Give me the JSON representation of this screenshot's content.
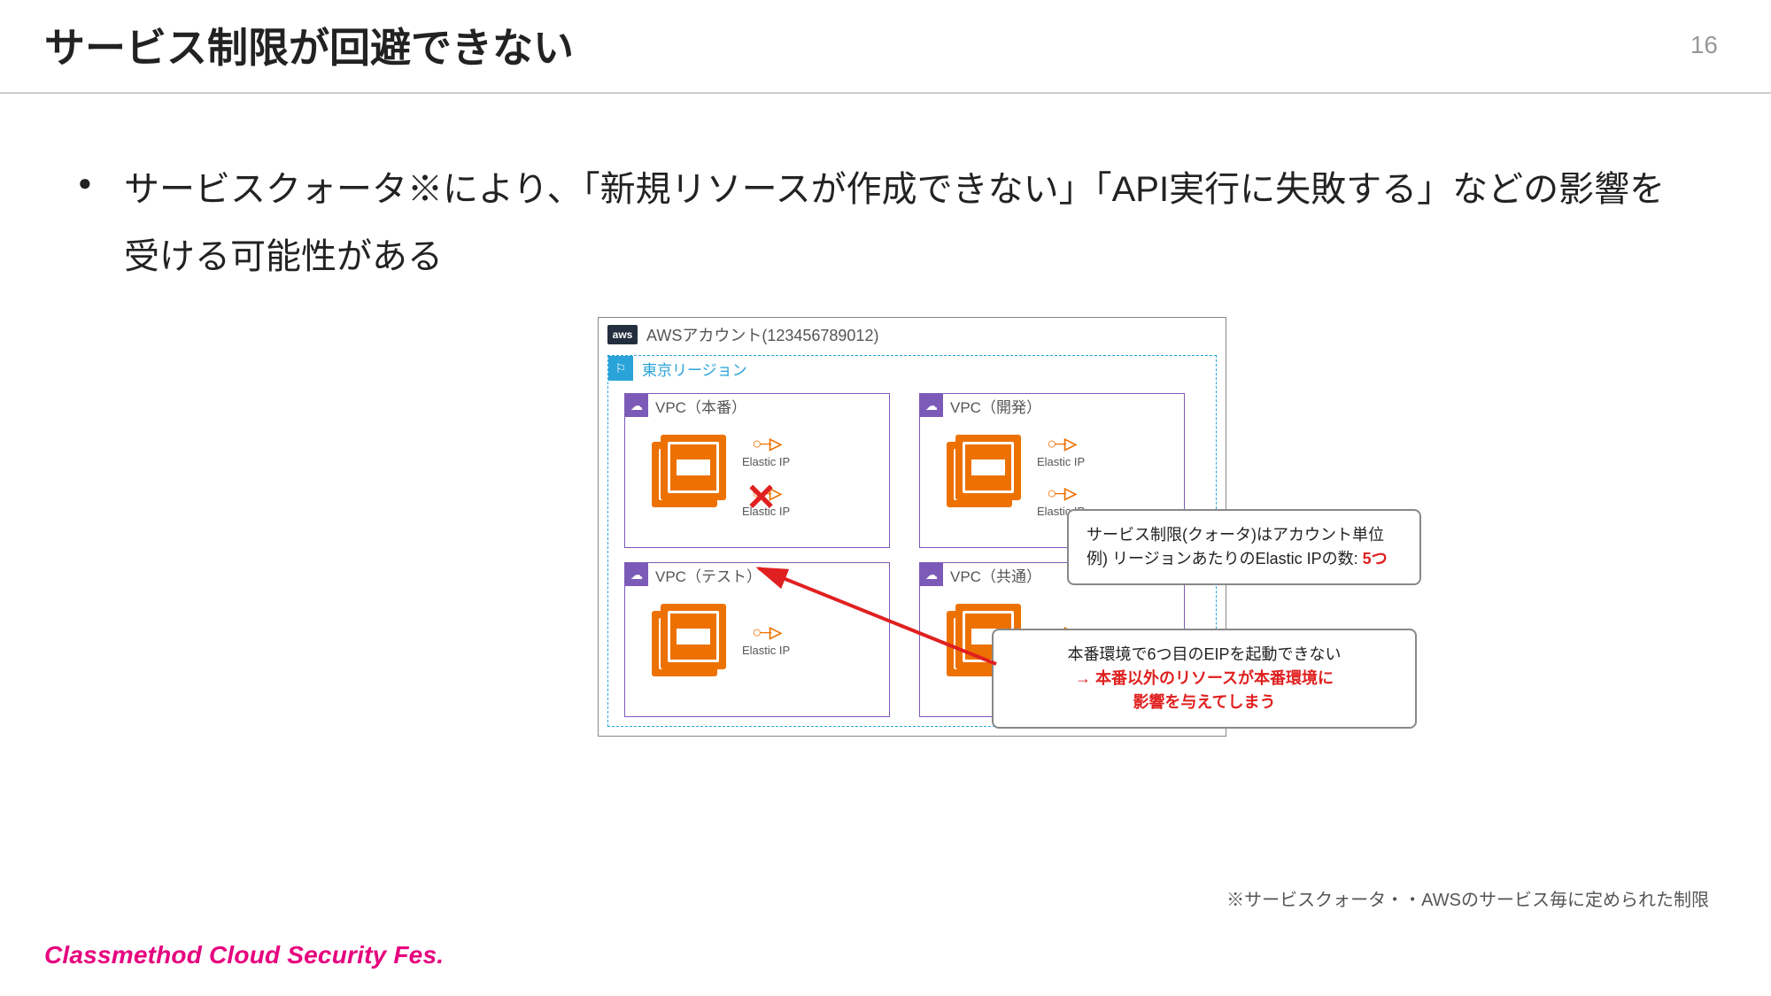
{
  "header": {
    "title": "サービス制限が回避できない",
    "page": "16"
  },
  "bullet": "サービスクォータ※により、「新規リソースが作成できない」「API実行に失敗する」などの影響を受ける可能性がある",
  "diagram": {
    "aws_label_badge": "aws",
    "aws_label": "AWSアカウント(123456789012)",
    "region_label": "東京リージョン",
    "eip_label": "Elastic IP",
    "vpcs": [
      {
        "label": "VPC（本番）"
      },
      {
        "label": "VPC（開発）"
      },
      {
        "label": "VPC（テスト）"
      },
      {
        "label": "VPC（共通）"
      }
    ]
  },
  "callout1": {
    "line1": "サービス制限(クォータ)はアカウント単位",
    "line2a": "例) リージョンあたりのElastic IPの数: ",
    "line2b": "5つ"
  },
  "callout2": {
    "line1": "本番環境で6つ目のEIPを起動できない",
    "line2": "→ 本番以外のリソースが本番環境に",
    "line3": "影響を与えてしまう"
  },
  "footnote": "※サービスクォータ・・AWSのサービス毎に定められた制限",
  "footer": "Classmethod Cloud Security Fes."
}
